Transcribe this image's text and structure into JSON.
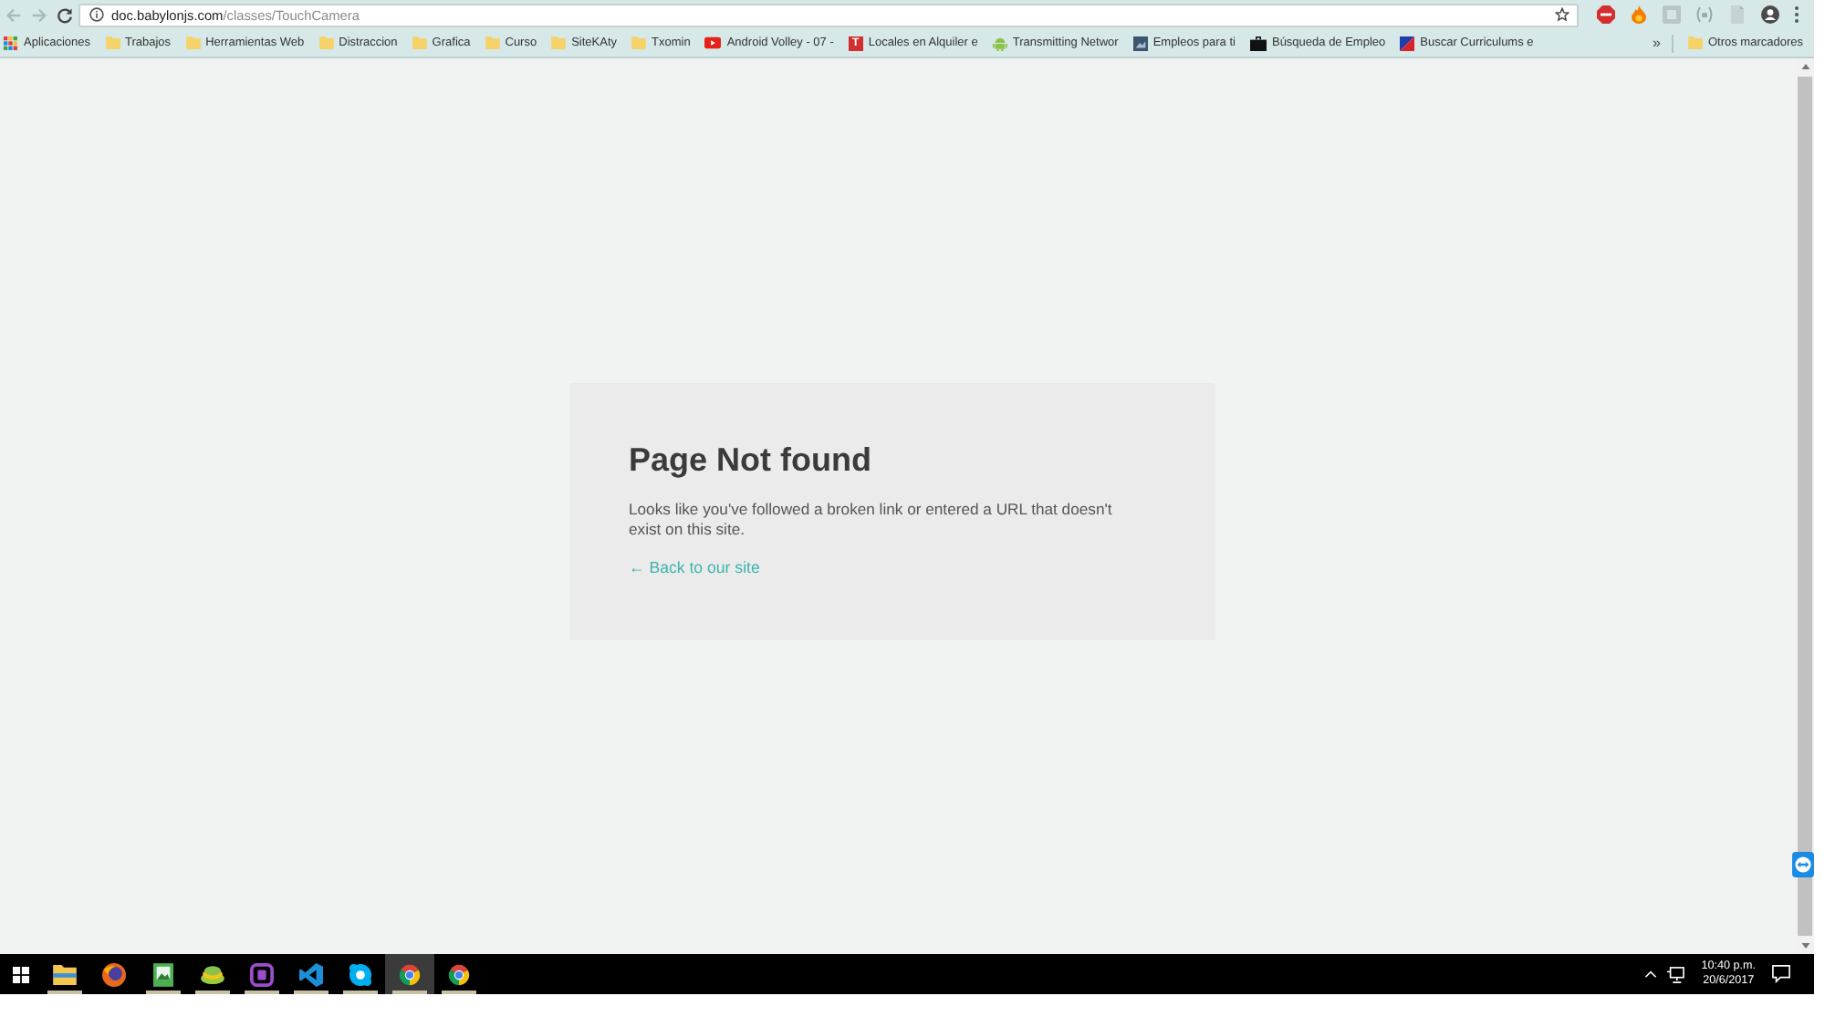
{
  "browser": {
    "navigation": [
      {
        "kind": "back",
        "disabled": true
      },
      {
        "kind": "forward",
        "disabled": true
      },
      {
        "kind": "reload",
        "disabled": false
      }
    ],
    "address": {
      "host": "doc.babylonjs.com",
      "path": "/classes/TouchCamera"
    },
    "bookmarks": [
      {
        "label": "Aplicaciones",
        "kind": "apps"
      },
      {
        "label": "Trabajos",
        "kind": "folder"
      },
      {
        "label": "Herramientas Web",
        "kind": "folder"
      },
      {
        "label": "Distraccion",
        "kind": "folder"
      },
      {
        "label": "Grafica",
        "kind": "folder"
      },
      {
        "label": "Curso",
        "kind": "folder"
      },
      {
        "label": "SiteKAty",
        "kind": "folder"
      },
      {
        "label": "Txomin",
        "kind": "folder"
      },
      {
        "label": "Android Volley - 07 -",
        "kind": "play"
      },
      {
        "label": "Locales en Alquiler e",
        "kind": "tile",
        "tile_letter": "T"
      },
      {
        "label": "Transmitting Networ",
        "kind": "robot"
      },
      {
        "label": "Empleos para ti",
        "kind": "square"
      },
      {
        "label": "Búsqueda de Empleo",
        "kind": "briefcase"
      },
      {
        "label": "Buscar Curriculums e",
        "kind": "flag"
      }
    ],
    "bookmarks_overflow": "»",
    "other_bookmarks": {
      "label": "Otros marcadores",
      "kind": "folder"
    }
  },
  "page": {
    "title": "Page Not found",
    "message": "Looks like you've followed a broken link or entered a URL that doesn't exist on this site.",
    "link": "← Back to our site"
  },
  "taskbar": {
    "apps": [
      {
        "kind": "folder",
        "running": true,
        "selected": false
      },
      {
        "kind": "globe",
        "running": false,
        "selected": false
      },
      {
        "kind": "picture",
        "running": true,
        "selected": false
      },
      {
        "kind": "stack",
        "running": true,
        "selected": false
      },
      {
        "kind": "badge",
        "running": true,
        "selected": false
      },
      {
        "kind": "ribbon",
        "running": true,
        "selected": false
      },
      {
        "kind": "chat",
        "running": true,
        "selected": false
      },
      {
        "kind": "browser",
        "running": true,
        "selected": true
      },
      {
        "kind": "browser",
        "running": true,
        "selected": false
      }
    ],
    "clock": {
      "time": "10:40 p.m.",
      "date": "20/6/2017"
    }
  }
}
